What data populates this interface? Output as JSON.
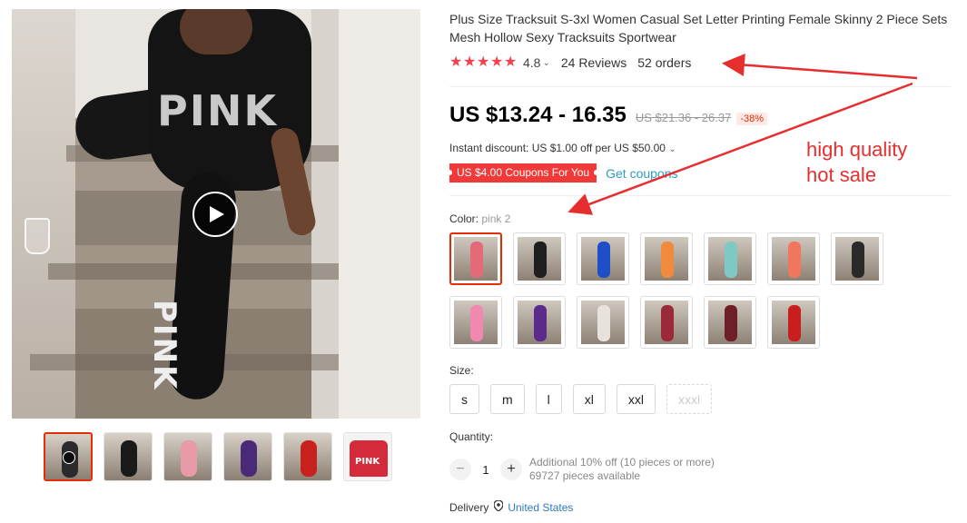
{
  "product": {
    "title": "Plus Size Tracksuit S-3xl Women Casual Set Letter Printing Female Skinny 2 Piece Sets Mesh Hollow Sexy Tracksuits Sportwear",
    "rating": "4.8",
    "reviews": "24 Reviews",
    "orders": "52 orders",
    "price": "US $13.24 - 16.35",
    "original_price": "US $21.36 - 26.37",
    "discount": "-38%",
    "instant_discount": "Instant discount: US $1.00 off per US $50.00",
    "coupon_badge": "US $4.00 Coupons For You",
    "get_coupons": "Get coupons"
  },
  "gallery": {
    "main_text": "PINK",
    "leg_text": "PINK",
    "thumbnails": [
      {
        "color": "#2b2b2b",
        "is_video": true
      },
      {
        "color": "#1a1a1a",
        "is_video": false
      },
      {
        "color": "#e89aa8",
        "is_video": false
      },
      {
        "color": "#4a2a78",
        "is_video": false
      },
      {
        "color": "#c9211d",
        "is_video": false
      },
      {
        "color": "#d42b3a",
        "is_video": false,
        "shirt_text": "PINK"
      }
    ]
  },
  "annotation": {
    "line1": "high quality",
    "line2": "hot sale"
  },
  "color": {
    "label": "Color:",
    "selected": "pink 2",
    "options": [
      {
        "name": "pink 2",
        "hex": "#e46a7a"
      },
      {
        "name": "black",
        "hex": "#1e1e1e"
      },
      {
        "name": "blue",
        "hex": "#1f4fc8"
      },
      {
        "name": "orange",
        "hex": "#f08a3c"
      },
      {
        "name": "aqua",
        "hex": "#7fc8c4"
      },
      {
        "name": "coral",
        "hex": "#f0765e"
      },
      {
        "name": "black 2",
        "hex": "#2a2a2a"
      },
      {
        "name": "pink",
        "hex": "#f088b0"
      },
      {
        "name": "purple",
        "hex": "#5b2a8a"
      },
      {
        "name": "white",
        "hex": "#e8e2dc"
      },
      {
        "name": "wine",
        "hex": "#9a2a3a"
      },
      {
        "name": "burgundy",
        "hex": "#6e1e26"
      },
      {
        "name": "red",
        "hex": "#c81e1e"
      }
    ]
  },
  "size": {
    "label": "Size:",
    "options": [
      "s",
      "m",
      "l",
      "xl",
      "xxl",
      "xxxl"
    ]
  },
  "quantity": {
    "label": "Quantity:",
    "value": "1",
    "minus": "−",
    "plus": "+",
    "additional": "Additional 10% off (10 pieces or more)",
    "available": "69727 pieces available"
  },
  "delivery": {
    "label": "Delivery",
    "country": "United States"
  },
  "colors": {
    "accent_red": "#e62e04",
    "annotation_red": "#e62e2e",
    "link_blue": "#2e9cc3"
  },
  "icons": [
    "play-icon",
    "star-icon",
    "chevron-down-icon",
    "location-pin-icon",
    "minus-icon",
    "plus-icon",
    "arrow-annotation"
  ]
}
